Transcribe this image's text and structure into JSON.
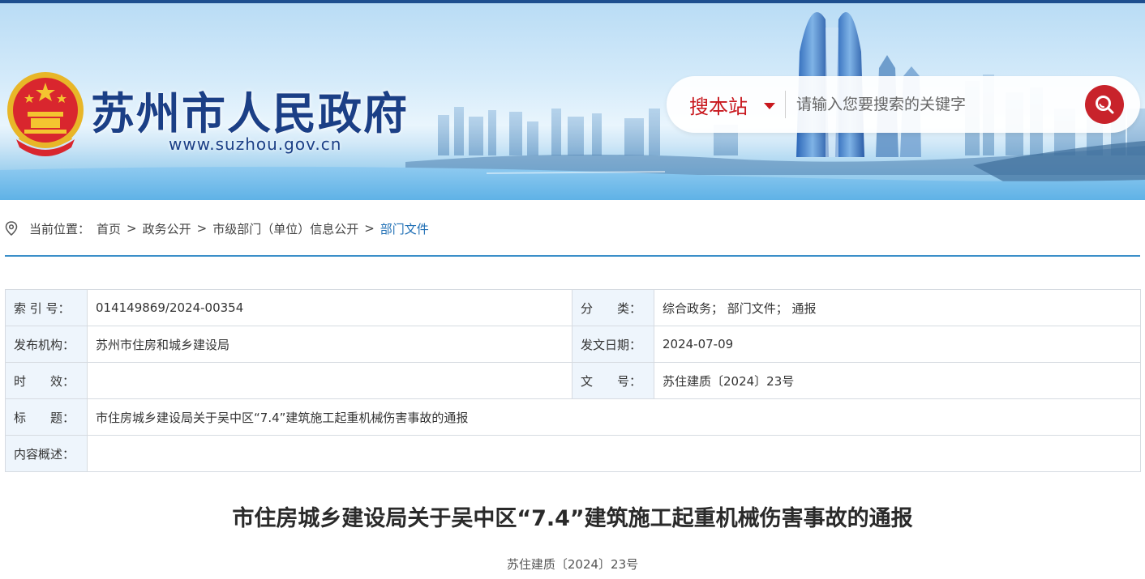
{
  "header": {
    "site_title": "苏州市人民政府",
    "site_url": "www.suzhou.gov.cn",
    "emblem_icon": "national-emblem-icon",
    "colors": {
      "brand_blue": "#1b3f86",
      "accent_red": "#c8232b",
      "link_blue": "#1f6fb5"
    }
  },
  "search": {
    "scope_label": "搜本站",
    "placeholder": "请输入您要搜索的关键字",
    "button_icon": "search-icon"
  },
  "breadcrumb": {
    "prefix": "当前位置：",
    "items": [
      "首页",
      "政务公开",
      "市级部门（单位）信息公开",
      "部门文件"
    ],
    "separator": ">"
  },
  "meta": {
    "index_label": "索 引 号：",
    "index_value": "014149869/2024-00354",
    "category_label": "分　　类：",
    "category_value": "综合政务； 部门文件； 通报",
    "publisher_label": "发布机构：",
    "publisher_value": "苏州市住房和城乡建设局",
    "date_label": "发文日期：",
    "date_value": "2024-07-09",
    "validity_label": "时　　效：",
    "validity_value": "",
    "docno_label": "文　　号：",
    "docno_value": "苏住建质〔2024〕23号",
    "title_label": "标　　题：",
    "title_value": "市住房城乡建设局关于吴中区“7.4”建筑施工起重机械伤害事故的通报",
    "summary_label": "内容概述：",
    "summary_value": ""
  },
  "article": {
    "title": "市住房城乡建设局关于吴中区“7.4”建筑施工起重机械伤害事故的通报",
    "doc_number": "苏住建质〔2024〕23号"
  }
}
